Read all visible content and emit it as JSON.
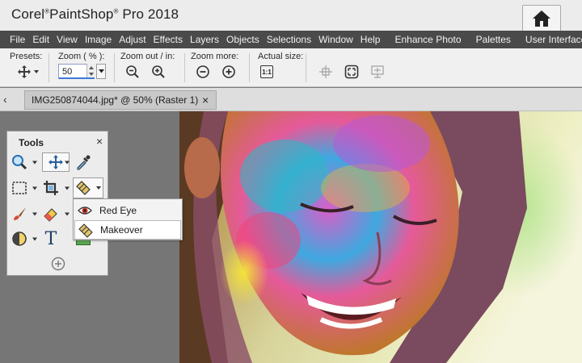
{
  "app": {
    "title_brand": "Corel",
    "title_product": "PaintShop",
    "title_rest": "Pro 2018",
    "home_icon": "home-icon"
  },
  "menu": {
    "items": [
      "File",
      "Edit",
      "View",
      "Image",
      "Adjust",
      "Effects",
      "Layers",
      "Objects",
      "Selections",
      "Window",
      "Help"
    ],
    "extra": [
      "Enhance Photo",
      "Palettes",
      "User Interface"
    ]
  },
  "toolbar": {
    "presets_label": "Presets:",
    "zoom_label": "Zoom ( % ):",
    "zoom_value": "50",
    "zoom_out_in_label": "Zoom out / in:",
    "zoom_more_label": "Zoom more:",
    "actual_size_label": "Actual size:",
    "actual_size_glyph": "1:1"
  },
  "tab": {
    "title": "IMG250874044.jpg* @  50% (Raster 1)",
    "scroll_glyph": "‹",
    "close_glyph": "×"
  },
  "tools": {
    "title": "Tools",
    "close_glyph": "×",
    "text_tool_glyph": "T",
    "flyout": [
      {
        "label": "Red Eye",
        "icon": "eye-icon"
      },
      {
        "label": "Makeover",
        "icon": "makeover-icon"
      }
    ]
  },
  "colors": {
    "menubar_bg": "#4a4a4a",
    "accent_blue": "#3d7ad8"
  }
}
